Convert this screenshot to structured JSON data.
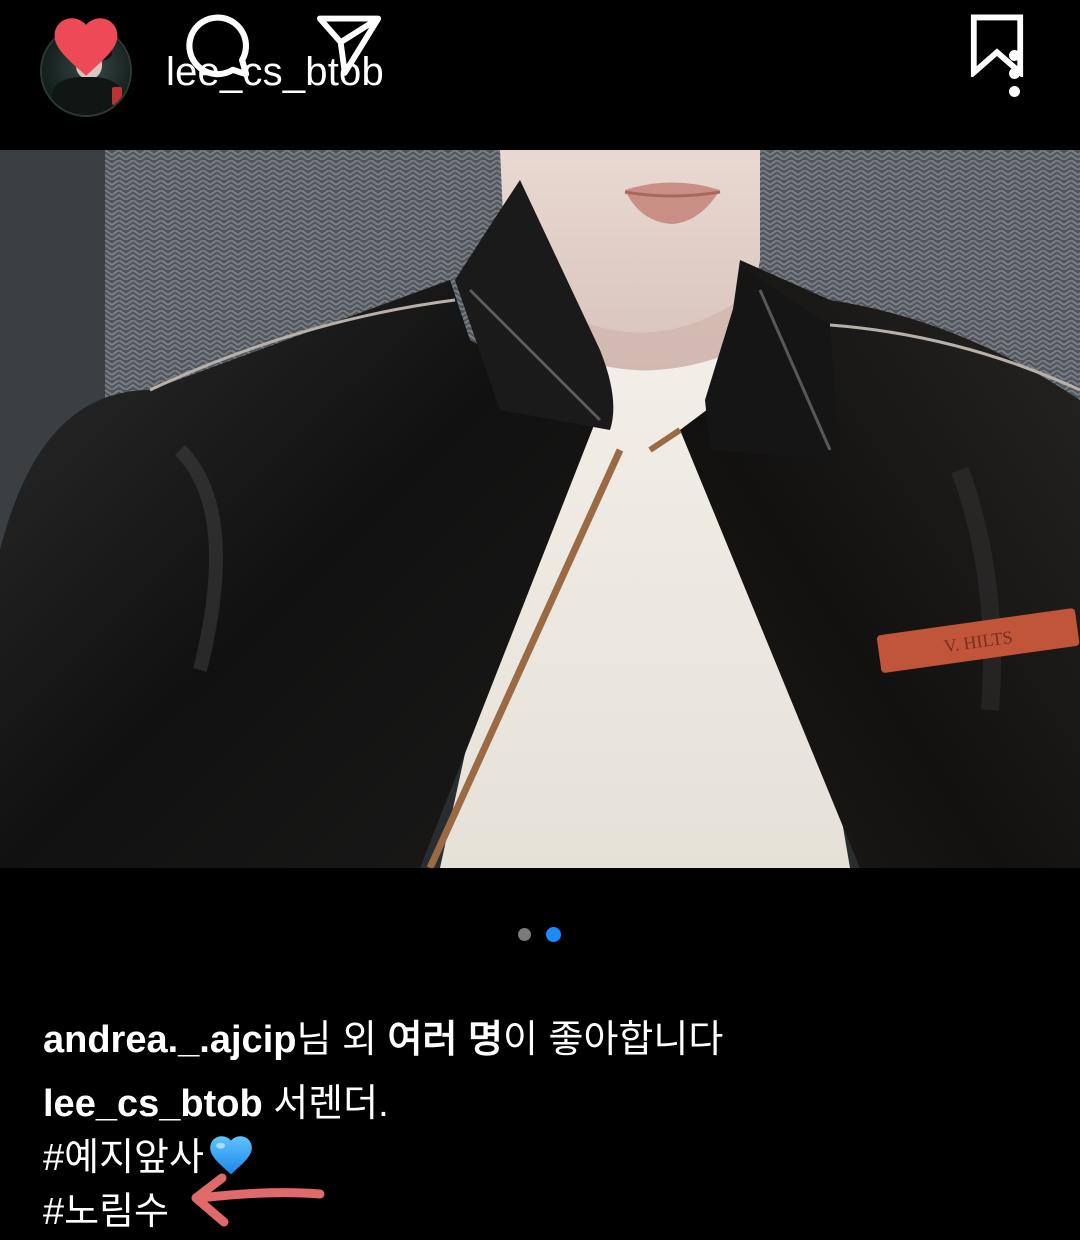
{
  "post": {
    "username": "lee_cs_btob",
    "more_icon": "more-vertical-icon",
    "photo_description_icon": "photo",
    "carousel": {
      "total": 2,
      "active": 2,
      "active_color": "#1a8cff",
      "inactive_color": "#7a7a7a"
    },
    "liked": true,
    "like_color": "#ed4956"
  },
  "likes": {
    "first_liker": "andrea._.ajcip",
    "text_a": "님 외 ",
    "bold_b": "여러 명",
    "text_c": "이 좋아합니다"
  },
  "caption": {
    "author": "lee_cs_btob",
    "text": " 서렌더.",
    "hashtag1": "#예지앞사",
    "hashtag2": "#노림수"
  },
  "annotation": {
    "arrow_color": "#e06a6a"
  }
}
